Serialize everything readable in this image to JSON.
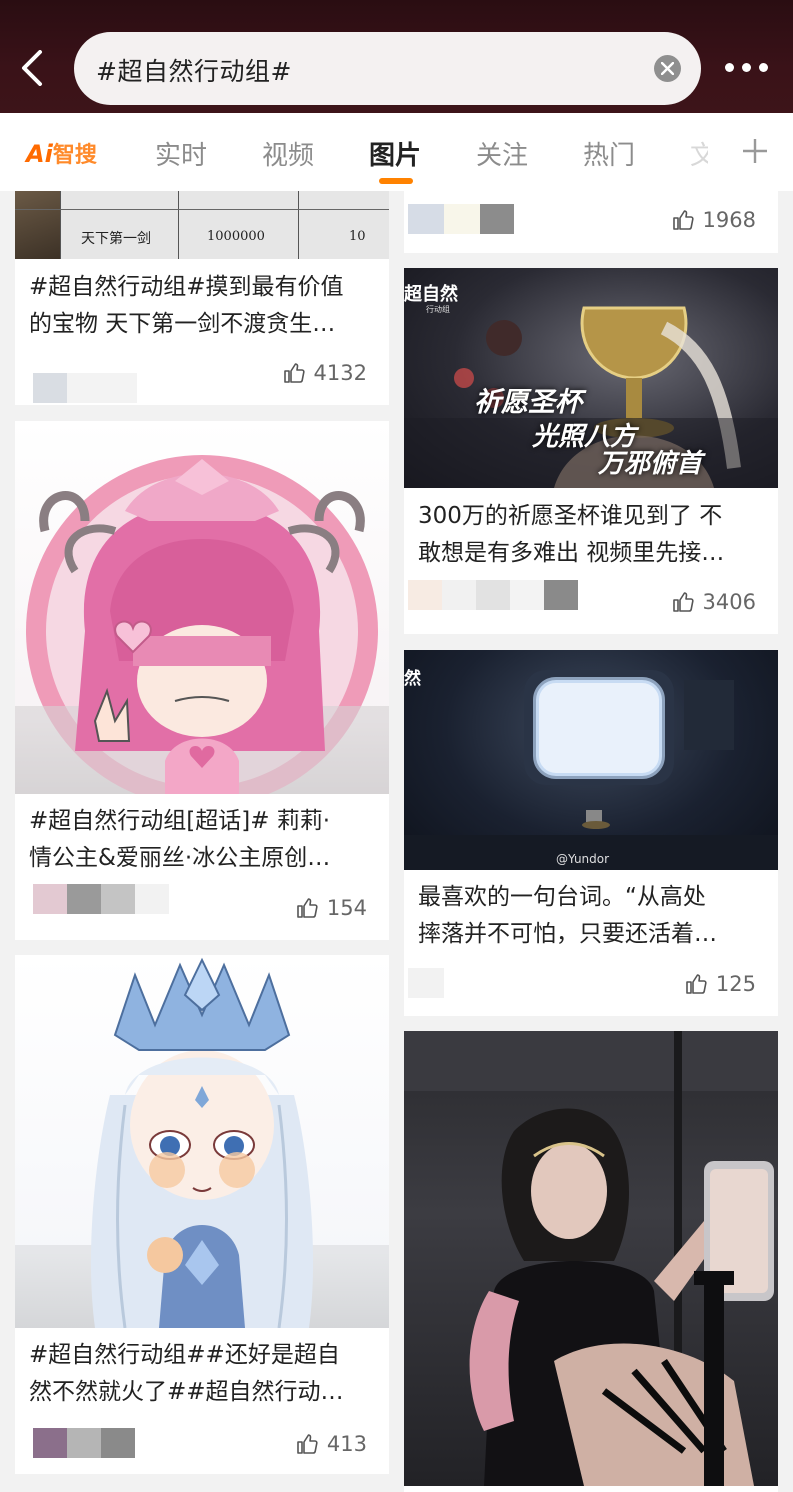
{
  "search": {
    "query": "#超自然行动组#"
  },
  "tabs": {
    "ai_logo": {
      "ai": "Ai",
      "label": "智搜"
    },
    "items": [
      "实时",
      "视频",
      "图片",
      "关注",
      "热门",
      "文"
    ],
    "active": "图片"
  },
  "left_column": [
    {
      "table_cells": [
        "天下第一剑",
        "1000000",
        "10"
      ],
      "title_line1": "#超自然行动组#摸到最有价值",
      "title_line2": "的宝物 天下第一剑不渡贪生…",
      "likes": "4132"
    },
    {
      "title_line1": "#超自然行动组[超话]# 莉莉·",
      "title_line2": "情公主&爱丽丝·冰公主原创…",
      "likes": "154"
    },
    {
      "title_line1": "#超自然行动组##还好是超自",
      "title_line2": "然不然就火了##超自然行动…",
      "likes": "413"
    }
  ],
  "right_column": [
    {
      "likes": "1968"
    },
    {
      "overlay_logo": "超自然",
      "overlay_logo_sub": "行动组",
      "overlay_line1": "祈愿圣杯",
      "overlay_line2": "光照八方",
      "overlay_line3": "万邪俯首",
      "title_line1": "300万的祈愿圣杯谁见到了 不",
      "title_line2": "敢想是有多难出 视频里先接…",
      "likes": "3406"
    },
    {
      "overlay_logo": "然",
      "watermark": "@Yundor",
      "title_line1": "最喜欢的一句台词。“从高处",
      "title_line2": "摔落并不可怕，只要还活着…",
      "likes": "125"
    },
    {}
  ],
  "colors": {
    "accent": "#ff8200",
    "header_bg": "#3a1218"
  }
}
